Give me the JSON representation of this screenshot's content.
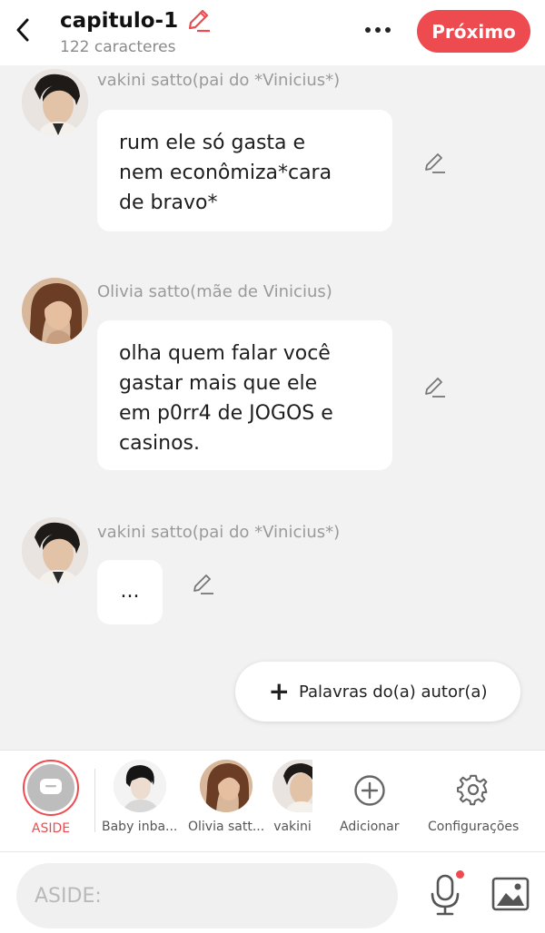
{
  "header": {
    "title": "capitulo-1",
    "subtitle": "122 caracteres",
    "next_label": "Próximo"
  },
  "messages": [
    {
      "speaker": "vakini satto(pai do *Vinicius*)",
      "text": "rum ele só gasta e\nnem econômiza*cara\nde bravo*",
      "avatar": "man-portrait"
    },
    {
      "speaker": "Olivia satto(mãe de Vinicius)",
      "text": "olha quem falar você\ngastar mais que ele\nem p0rr4 de JOGOS e\ncasinos.",
      "avatar": "woman-portrait"
    },
    {
      "speaker": "vakini satto(pai do *Vinicius*)",
      "text": "...",
      "avatar": "man-portrait"
    }
  ],
  "author_words": {
    "label": "Palavras do(a) autor(a)"
  },
  "characters": {
    "aside_label": "ASIDE",
    "items": [
      {
        "label": "Baby inba..."
      },
      {
        "label": "Olivia satt..."
      },
      {
        "label": "vakini"
      }
    ],
    "add_label": "Adicionar",
    "settings_label": "Configurações"
  },
  "input": {
    "placeholder": "ASIDE:"
  },
  "colors": {
    "accent": "#ee4b51"
  }
}
